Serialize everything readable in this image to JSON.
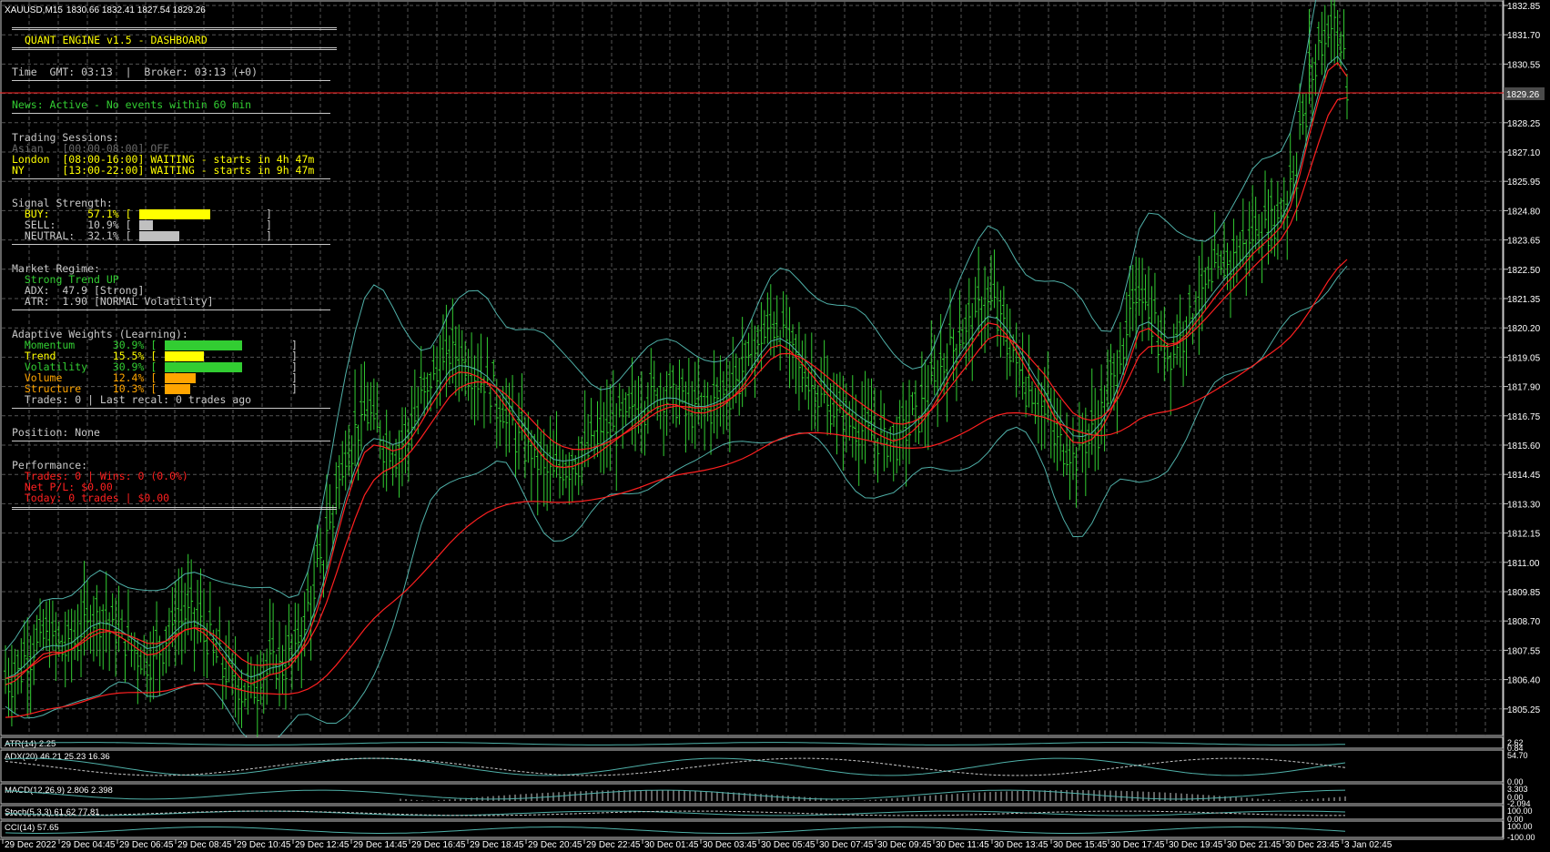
{
  "symbol_header": {
    "symbol": "XAUUSD,M15",
    "ohlc": "1830.66 1832.41 1827.54 1829.26"
  },
  "dashboard": {
    "title": "QUANT ENGINE v1.5 - DASHBOARD",
    "time_line": "Time  GMT: 03:13  |  Broker: 03:13 (+0)",
    "news": "News: Active - No events within 60 min",
    "sessions": {
      "heading": "Trading Sessions:",
      "rows": [
        {
          "text": "Asian   [00:00-08:00] OFF",
          "color": "#6a6a6a"
        },
        {
          "text": "London  [08:00-16:00] WAITING - starts in 4h 47m",
          "color": "#ffff00"
        },
        {
          "text": "NY      [13:00-22:00] WAITING - starts in 9h 47m",
          "color": "#ffff00"
        }
      ]
    },
    "signal": {
      "heading": "Signal Strength:",
      "rows": [
        {
          "label": "  BUY:      57.1% [",
          "value": 57.1,
          "color": "#ffff00",
          "label_color": "#ffff00"
        },
        {
          "label": "  SELL:     10.9% [",
          "value": 10.9,
          "color": "#c0c0c0",
          "label_color": "#c8c8c8"
        },
        {
          "label": "  NEUTRAL:  32.1% [",
          "value": 32.1,
          "color": "#c0c0c0",
          "label_color": "#c8c8c8"
        }
      ],
      "close_bracket": "]"
    },
    "regime": {
      "heading": "Market Regime:",
      "trend": "  Strong Trend UP",
      "adx": "  ADX:  47.9 [Strong]",
      "atr": "  ATR:  1.90 [NORMAL Volatility]"
    },
    "weights": {
      "heading": "Adaptive Weights (Learning):",
      "rows": [
        {
          "label": "  Momentum      30.9% [",
          "value": 30.9,
          "color": "#32cd32",
          "label_color": "#32cd32"
        },
        {
          "label": "  Trend         15.5% [",
          "value": 15.5,
          "color": "#ffff00",
          "label_color": "#ffff00"
        },
        {
          "label": "  Volatility    30.9% [",
          "value": 30.9,
          "color": "#32cd32",
          "label_color": "#32cd32"
        },
        {
          "label": "  Volume        12.4% [",
          "value": 12.4,
          "color": "#ffa500",
          "label_color": "#ffa500"
        },
        {
          "label": "  Structure     10.3% [",
          "value": 10.3,
          "color": "#ffa500",
          "label_color": "#ffa500"
        }
      ],
      "close_bracket": "]",
      "footer": "  Trades: 0 | Last recal: 0 trades ago"
    },
    "position": "Position: None",
    "performance": {
      "heading": "Performance:",
      "lines": [
        "  Trades: 0 | Wins: 0 (0.0%)",
        "  Net P/L: $0.00",
        "  Today: 0 trades | $0.00"
      ]
    }
  },
  "chart_data": {
    "type": "candlestick",
    "ylim": [
      1804.4,
      1832.6
    ],
    "price_ticks": [
      "1832.85",
      "1831.70",
      "1830.55",
      "1829.40",
      "1828.25",
      "1827.10",
      "1825.95",
      "1824.80",
      "1823.65",
      "1822.50",
      "1821.35",
      "1820.20",
      "1819.05",
      "1817.90",
      "1816.75",
      "1815.60",
      "1814.45",
      "1813.30",
      "1812.15",
      "1811.00",
      "1809.85",
      "1808.70",
      "1807.55",
      "1806.40",
      "1805.25"
    ],
    "current_price": "1829.26",
    "time_ticks": [
      "29 Dec 2022",
      "29 Dec 04:45",
      "29 Dec 06:45",
      "29 Dec 08:45",
      "29 Dec 10:45",
      "29 Dec 12:45",
      "29 Dec 14:45",
      "29 Dec 16:45",
      "29 Dec 18:45",
      "29 Dec 20:45",
      "29 Dec 22:45",
      "30 Dec 01:45",
      "30 Dec 03:45",
      "30 Dec 05:45",
      "30 Dec 07:45",
      "30 Dec 09:45",
      "30 Dec 11:45",
      "30 Dec 13:45",
      "30 Dec 15:45",
      "30 Dec 17:45",
      "30 Dec 19:45",
      "30 Dec 21:45",
      "30 Dec 23:45",
      "3 Jan 02:45"
    ],
    "close_series": [
      1806.6,
      1807.0,
      1807.6,
      1808.0,
      1808.3,
      1808.0,
      1807.8,
      1808.2,
      1808.7,
      1809.1,
      1809.0,
      1808.6,
      1808.2,
      1807.9,
      1807.6,
      1807.4,
      1807.9,
      1808.4,
      1809.0,
      1809.2,
      1808.9,
      1808.3,
      1807.6,
      1807.0,
      1806.5,
      1806.2,
      1806.4,
      1807.0,
      1807.3,
      1807.2,
      1807.6,
      1808.4,
      1809.6,
      1811.0,
      1812.7,
      1814.4,
      1815.6,
      1816.4,
      1816.9,
      1816.3,
      1815.7,
      1815.4,
      1815.9,
      1816.8,
      1817.6,
      1818.3,
      1818.8,
      1819.3,
      1819.0,
      1818.6,
      1818.3,
      1817.9,
      1817.2,
      1816.6,
      1816.0,
      1815.6,
      1815.1,
      1814.7,
      1814.6,
      1814.9,
      1815.1,
      1815.4,
      1815.7,
      1816.0,
      1816.3,
      1816.6,
      1816.9,
      1817.2,
      1817.6,
      1817.7,
      1817.6,
      1817.4,
      1817.0,
      1816.9,
      1817.1,
      1817.4,
      1817.7,
      1818.2,
      1818.7,
      1819.4,
      1820.0,
      1820.3,
      1819.9,
      1819.2,
      1818.6,
      1818.1,
      1817.6,
      1817.2,
      1816.9,
      1816.6,
      1816.4,
      1816.2,
      1816.0,
      1815.9,
      1815.8,
      1816.3,
      1816.8,
      1817.3,
      1818.0,
      1818.8,
      1819.5,
      1820.0,
      1820.4,
      1821.0,
      1821.2,
      1820.4,
      1819.5,
      1818.6,
      1817.9,
      1817.3,
      1816.9,
      1815.9,
      1815.6,
      1815.3,
      1815.9,
      1816.3,
      1817.1,
      1818.2,
      1819.5,
      1820.8,
      1821.8,
      1820.6,
      1819.6,
      1819.3,
      1819.9,
      1820.6,
      1821.3,
      1821.8,
      1822.3,
      1822.7,
      1823.0,
      1823.4,
      1823.9,
      1824.1,
      1824.4,
      1824.9,
      1826.2,
      1828.2,
      1830.1,
      1831.3,
      1832.0,
      1831.1,
      1829.3
    ]
  },
  "indicators": [
    {
      "label": "ATR(14) 2.25",
      "scale": [
        "2.62",
        "0.84"
      ]
    },
    {
      "label": "ADX(20) 46.21 25.23 16.36",
      "scale": [
        "54.70",
        "0.00"
      ]
    },
    {
      "label": "MACD(12,26,9) 2.806 2.398",
      "scale": [
        "3.303",
        "0.00",
        "-2.094"
      ]
    },
    {
      "label": "Stoch(5,3,3) 61.62 77.81",
      "scale": [
        "100.00",
        "0.00"
      ]
    },
    {
      "label": "CCI(14) 57.65",
      "scale": [
        "100.00",
        "-100.00"
      ]
    }
  ],
  "colors": {
    "bull": "#32cd32",
    "ma": "#ff2020",
    "band": "#4fb0a8",
    "grid": "#555555",
    "axis_text": "#ffffff"
  }
}
